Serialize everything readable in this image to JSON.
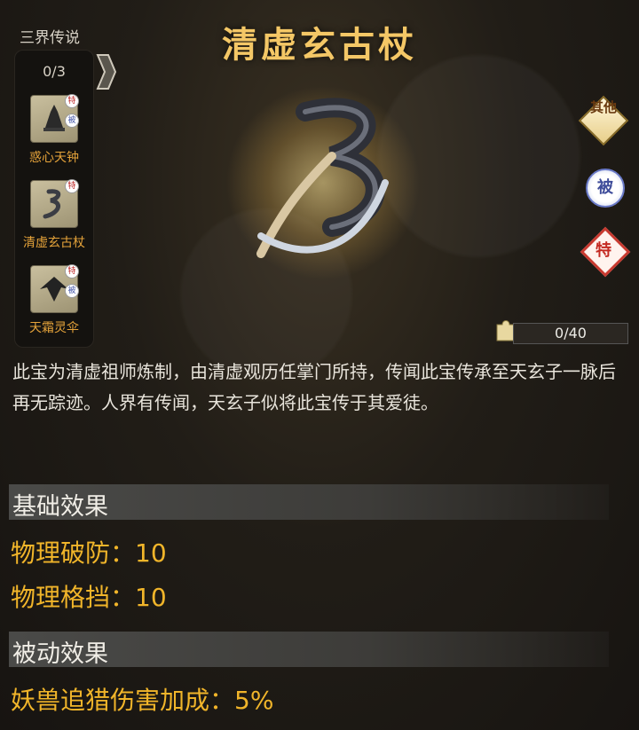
{
  "series": {
    "title": "三界传说",
    "progress": "0/3"
  },
  "side_items": [
    {
      "label": "惑心天钟",
      "icon": "bell-icon",
      "tags": [
        "特",
        "被"
      ]
    },
    {
      "label": "清虚玄古杖",
      "icon": "staff-icon",
      "tags": [
        "特"
      ]
    },
    {
      "label": "天霜灵伞",
      "icon": "umbrella-icon",
      "tags": [
        "特",
        "被"
      ]
    }
  ],
  "item": {
    "name": "清虚玄古杖",
    "fragments": "0/40",
    "description": "此宝为清虚祖师炼制，由清虚观历任掌门所持，传闻此宝传承至天玄子一脉后再无踪迹。人界有传闻，天玄子似将此宝传于其爱徒。"
  },
  "badges": {
    "other": "其他",
    "passive": "被",
    "special": "特"
  },
  "basic": {
    "title": "基础效果",
    "stats": [
      "物理破防：10",
      "物理格挡：10"
    ]
  },
  "passive": {
    "title": "被动效果",
    "stats": [
      "妖兽追猎伤害加成：5%"
    ]
  },
  "colors": {
    "title": "#f4c766",
    "stat": "#f1b52a",
    "label": "#e5a33a"
  }
}
